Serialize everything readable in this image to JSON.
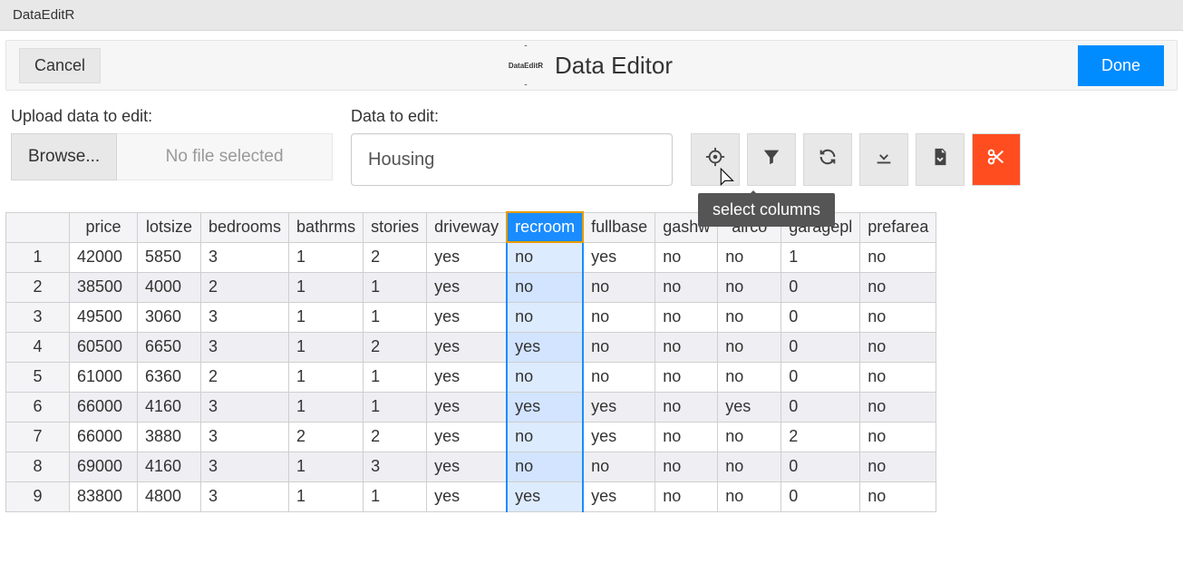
{
  "window": {
    "title": "DataEditR"
  },
  "header": {
    "cancel_label": "Cancel",
    "app_title": "Data Editor",
    "logo_text": "DataEditR",
    "done_label": "Done"
  },
  "upload": {
    "label": "Upload data to edit:",
    "browse_label": "Browse...",
    "status_text": "No file selected"
  },
  "data_select": {
    "label": "Data to edit:",
    "value": "Housing"
  },
  "toolbar": {
    "select_columns_tooltip": "select columns"
  },
  "table": {
    "selected_column": "recroom",
    "columns": [
      "price",
      "lotsize",
      "bedrooms",
      "bathrms",
      "stories",
      "driveway",
      "recroom",
      "fullbase",
      "gashw",
      "airco",
      "garagepl",
      "prefarea"
    ],
    "rows": [
      {
        "n": "1",
        "price": "42000",
        "lotsize": "5850",
        "bedrooms": "3",
        "bathrms": "1",
        "stories": "2",
        "driveway": "yes",
        "recroom": "no",
        "fullbase": "yes",
        "gashw": "no",
        "airco": "no",
        "garagepl": "1",
        "prefarea": "no"
      },
      {
        "n": "2",
        "price": "38500",
        "lotsize": "4000",
        "bedrooms": "2",
        "bathrms": "1",
        "stories": "1",
        "driveway": "yes",
        "recroom": "no",
        "fullbase": "no",
        "gashw": "no",
        "airco": "no",
        "garagepl": "0",
        "prefarea": "no"
      },
      {
        "n": "3",
        "price": "49500",
        "lotsize": "3060",
        "bedrooms": "3",
        "bathrms": "1",
        "stories": "1",
        "driveway": "yes",
        "recroom": "no",
        "fullbase": "no",
        "gashw": "no",
        "airco": "no",
        "garagepl": "0",
        "prefarea": "no"
      },
      {
        "n": "4",
        "price": "60500",
        "lotsize": "6650",
        "bedrooms": "3",
        "bathrms": "1",
        "stories": "2",
        "driveway": "yes",
        "recroom": "yes",
        "fullbase": "no",
        "gashw": "no",
        "airco": "no",
        "garagepl": "0",
        "prefarea": "no"
      },
      {
        "n": "5",
        "price": "61000",
        "lotsize": "6360",
        "bedrooms": "2",
        "bathrms": "1",
        "stories": "1",
        "driveway": "yes",
        "recroom": "no",
        "fullbase": "no",
        "gashw": "no",
        "airco": "no",
        "garagepl": "0",
        "prefarea": "no"
      },
      {
        "n": "6",
        "price": "66000",
        "lotsize": "4160",
        "bedrooms": "3",
        "bathrms": "1",
        "stories": "1",
        "driveway": "yes",
        "recroom": "yes",
        "fullbase": "yes",
        "gashw": "no",
        "airco": "yes",
        "garagepl": "0",
        "prefarea": "no"
      },
      {
        "n": "7",
        "price": "66000",
        "lotsize": "3880",
        "bedrooms": "3",
        "bathrms": "2",
        "stories": "2",
        "driveway": "yes",
        "recroom": "no",
        "fullbase": "yes",
        "gashw": "no",
        "airco": "no",
        "garagepl": "2",
        "prefarea": "no"
      },
      {
        "n": "8",
        "price": "69000",
        "lotsize": "4160",
        "bedrooms": "3",
        "bathrms": "1",
        "stories": "3",
        "driveway": "yes",
        "recroom": "no",
        "fullbase": "no",
        "gashw": "no",
        "airco": "no",
        "garagepl": "0",
        "prefarea": "no"
      },
      {
        "n": "9",
        "price": "83800",
        "lotsize": "4800",
        "bedrooms": "3",
        "bathrms": "1",
        "stories": "1",
        "driveway": "yes",
        "recroom": "yes",
        "fullbase": "yes",
        "gashw": "no",
        "airco": "no",
        "garagepl": "0",
        "prefarea": "no"
      }
    ]
  }
}
